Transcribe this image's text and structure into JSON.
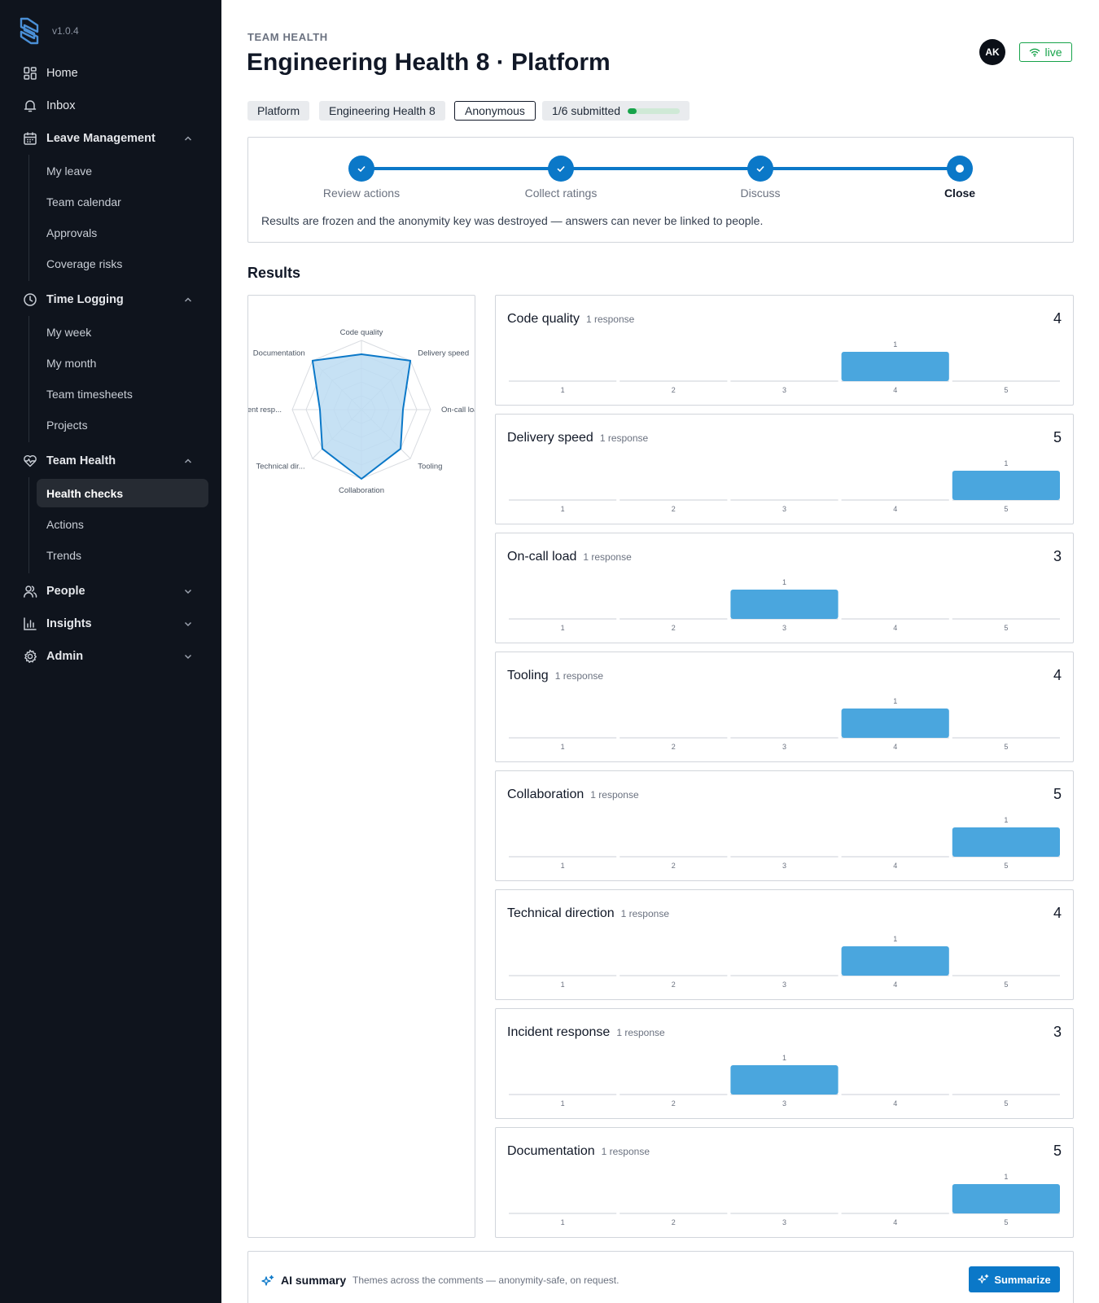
{
  "app": {
    "version": "v1.0.4"
  },
  "sidebar": {
    "home": "Home",
    "inbox": "Inbox",
    "leave": {
      "label": "Leave Management",
      "items": [
        "My leave",
        "Team calendar",
        "Approvals",
        "Coverage risks"
      ]
    },
    "time": {
      "label": "Time Logging",
      "items": [
        "My week",
        "My month",
        "Team timesheets",
        "Projects"
      ]
    },
    "health": {
      "label": "Team Health",
      "items": [
        "Health checks",
        "Actions",
        "Trends"
      ],
      "active": "Health checks"
    },
    "people": "People",
    "insights": "Insights",
    "admin": "Admin"
  },
  "header": {
    "eyebrow": "TEAM HEALTH",
    "title": "Engineering Health 8 · Platform",
    "avatar_initials": "AK",
    "live_label": "live",
    "live_color": "#16a34a"
  },
  "chips": {
    "team": "Platform",
    "check": "Engineering Health 8",
    "mode": "Anonymous",
    "submitted": "1/6 submitted",
    "submitted_fraction": 0.1667
  },
  "stepper": {
    "steps": [
      "Review actions",
      "Collect ratings",
      "Discuss",
      "Close"
    ],
    "current_index": 3,
    "note": "Results are frozen and the anonymity key was destroyed — answers can never be linked to people."
  },
  "results": {
    "heading": "Results",
    "radar_labels": [
      "Code quality",
      "Delivery speed",
      "On-call loa",
      "Tooling",
      "Collaboration",
      "Technical dir...",
      "ident resp...",
      "Documentation"
    ],
    "metrics": [
      {
        "name": "Code quality",
        "responses": "1 response",
        "score": "4"
      },
      {
        "name": "Delivery speed",
        "responses": "1 response",
        "score": "5"
      },
      {
        "name": "On-call load",
        "responses": "1 response",
        "score": "3"
      },
      {
        "name": "Tooling",
        "responses": "1 response",
        "score": "4"
      },
      {
        "name": "Collaboration",
        "responses": "1 response",
        "score": "5"
      },
      {
        "name": "Technical direction",
        "responses": "1 response",
        "score": "4"
      },
      {
        "name": "Incident response",
        "responses": "1 response",
        "score": "3"
      },
      {
        "name": "Documentation",
        "responses": "1 response",
        "score": "5"
      }
    ]
  },
  "chart_data": [
    {
      "type": "radar",
      "categories": [
        "Code quality",
        "Delivery speed",
        "On-call load",
        "Tooling",
        "Collaboration",
        "Technical direction",
        "Incident response",
        "Documentation"
      ],
      "values": [
        4,
        5,
        3,
        4,
        5,
        4,
        3,
        5
      ],
      "range": [
        0,
        5
      ],
      "fill_color": "#bcdcf2",
      "stroke_color": "#0b78c8"
    },
    {
      "type": "bar",
      "title": "Code quality",
      "categories": [
        "1",
        "2",
        "3",
        "4",
        "5"
      ],
      "values": [
        0,
        0,
        0,
        1,
        0
      ],
      "data_labels": [
        "",
        "",
        "",
        "1",
        ""
      ],
      "color": "#4aa6de"
    },
    {
      "type": "bar",
      "title": "Delivery speed",
      "categories": [
        "1",
        "2",
        "3",
        "4",
        "5"
      ],
      "values": [
        0,
        0,
        0,
        0,
        1
      ],
      "data_labels": [
        "",
        "",
        "",
        "",
        "1"
      ],
      "color": "#4aa6de"
    },
    {
      "type": "bar",
      "title": "On-call load",
      "categories": [
        "1",
        "2",
        "3",
        "4",
        "5"
      ],
      "values": [
        0,
        0,
        1,
        0,
        0
      ],
      "data_labels": [
        "",
        "",
        "1",
        "",
        ""
      ],
      "color": "#4aa6de"
    },
    {
      "type": "bar",
      "title": "Tooling",
      "categories": [
        "1",
        "2",
        "3",
        "4",
        "5"
      ],
      "values": [
        0,
        0,
        0,
        1,
        0
      ],
      "data_labels": [
        "",
        "",
        "",
        "1",
        ""
      ],
      "color": "#4aa6de"
    },
    {
      "type": "bar",
      "title": "Collaboration",
      "categories": [
        "1",
        "2",
        "3",
        "4",
        "5"
      ],
      "values": [
        0,
        0,
        0,
        0,
        1
      ],
      "data_labels": [
        "",
        "",
        "",
        "",
        "1"
      ],
      "color": "#4aa6de"
    },
    {
      "type": "bar",
      "title": "Technical direction",
      "categories": [
        "1",
        "2",
        "3",
        "4",
        "5"
      ],
      "values": [
        0,
        0,
        0,
        1,
        0
      ],
      "data_labels": [
        "",
        "",
        "",
        "1",
        ""
      ],
      "color": "#4aa6de"
    },
    {
      "type": "bar",
      "title": "Incident response",
      "categories": [
        "1",
        "2",
        "3",
        "4",
        "5"
      ],
      "values": [
        0,
        0,
        1,
        0,
        0
      ],
      "data_labels": [
        "",
        "",
        "1",
        "",
        ""
      ],
      "color": "#4aa6de"
    },
    {
      "type": "bar",
      "title": "Documentation",
      "categories": [
        "1",
        "2",
        "3",
        "4",
        "5"
      ],
      "values": [
        0,
        0,
        0,
        0,
        1
      ],
      "data_labels": [
        "",
        "",
        "",
        "",
        "1"
      ],
      "color": "#4aa6de"
    }
  ],
  "ai_summary": {
    "title": "AI summary",
    "subtitle": "Themes across the comments — anonymity-safe, on request.",
    "button": "Summarize"
  },
  "icons": {
    "home": "grid-icon",
    "inbox": "bell-icon",
    "leave": "calendar-icon",
    "time": "clock-icon",
    "health": "heart-pulse-icon",
    "people": "users-icon",
    "insights": "bar-chart-icon",
    "admin": "gear-icon",
    "live": "wifi-icon",
    "ai": "sparkles-icon"
  }
}
